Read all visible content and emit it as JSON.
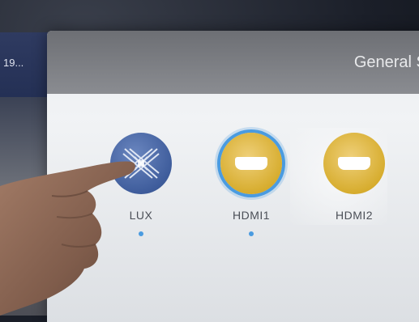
{
  "side_panel": {
    "label": "19..."
  },
  "window": {
    "title": "General Se"
  },
  "sources": [
    {
      "label": "LUX",
      "icon": "lux-logo-icon",
      "selected": false
    },
    {
      "label": "HDMI1",
      "icon": "hdmi-port-icon",
      "selected": true
    },
    {
      "label": "HDMI2",
      "icon": "hdmi-port-icon",
      "selected": false
    }
  ],
  "colors": {
    "accent": "#4a9be0",
    "hdmi_yellow": "#d7ad2f",
    "lux_blue": "#3f5d9c"
  }
}
